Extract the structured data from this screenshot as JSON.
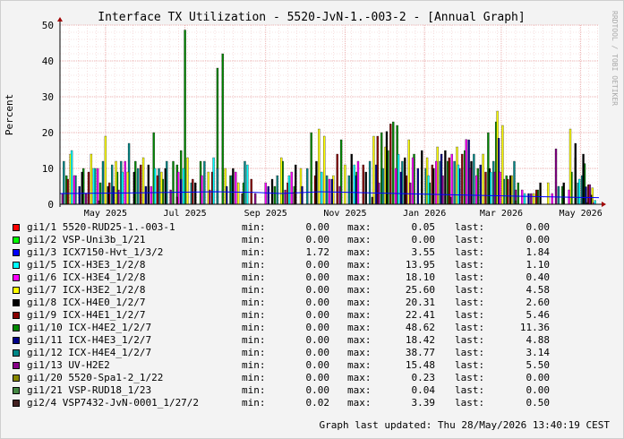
{
  "chart_data": {
    "type": "bar",
    "title": "Interface TX Utilization - 5520-JvN-1.-003-2 - [Annual Graph]",
    "ylabel": "Percent",
    "watermark": "RRDTOOL / TOBI OETIKER",
    "ylim": [
      0,
      50
    ],
    "yticks": [
      "0",
      "10",
      "20",
      "30",
      "40",
      "50"
    ],
    "xticks": [
      {
        "label": "May 2025",
        "day": 35
      },
      {
        "label": "Jul 2025",
        "day": 96
      },
      {
        "label": "Sep 2025",
        "day": 158
      },
      {
        "label": "Nov 2025",
        "day": 219
      },
      {
        "label": "Jan 2026",
        "day": 280
      },
      {
        "label": "Mar 2026",
        "day": 339
      },
      {
        "label": "May 2026",
        "day": 400
      }
    ],
    "x_range_days": [
      0,
      414
    ],
    "grid": true,
    "series": [
      {
        "name": "gi1/10 ICX-H4E2_1/2/7",
        "color": "#008800",
        "points": [
          [
            5,
            8
          ],
          [
            18,
            10
          ],
          [
            31,
            6
          ],
          [
            44,
            9
          ],
          [
            58,
            12
          ],
          [
            72,
            20
          ],
          [
            79,
            7
          ],
          [
            87,
            12
          ],
          [
            90,
            11
          ],
          [
            93,
            15
          ],
          [
            96,
            48.62
          ],
          [
            108,
            12
          ],
          [
            121,
            38
          ],
          [
            125,
            42
          ],
          [
            131,
            8
          ],
          [
            141,
            6
          ],
          [
            165,
            5
          ],
          [
            171,
            12
          ],
          [
            180,
            5
          ],
          [
            193,
            20
          ],
          [
            216,
            18
          ],
          [
            228,
            9
          ],
          [
            247,
            20
          ],
          [
            252,
            15
          ],
          [
            256,
            23
          ],
          [
            259,
            22
          ],
          [
            272,
            14
          ],
          [
            284,
            6
          ],
          [
            298,
            12
          ],
          [
            311,
            15
          ],
          [
            321,
            10
          ],
          [
            329,
            20
          ],
          [
            335,
            23
          ],
          [
            343,
            8
          ],
          [
            352,
            6
          ],
          [
            367,
            4
          ],
          [
            386,
            5
          ],
          [
            393,
            9
          ],
          [
            403,
            11.36
          ]
        ]
      },
      {
        "name": "gi1/12 ICX-H4E4_1/2/7",
        "color": "#008888",
        "points": [
          [
            3,
            12
          ],
          [
            12,
            8
          ],
          [
            27,
            10
          ],
          [
            33,
            12
          ],
          [
            40,
            11
          ],
          [
            47,
            12
          ],
          [
            53,
            17
          ],
          [
            60,
            10
          ],
          [
            76,
            10
          ],
          [
            82,
            12
          ],
          [
            101,
            6
          ],
          [
            111,
            12
          ],
          [
            121,
            10
          ],
          [
            132,
            8
          ],
          [
            142,
            12
          ],
          [
            167,
            8
          ],
          [
            190,
            10
          ],
          [
            205,
            8
          ],
          [
            222,
            8
          ],
          [
            238,
            12
          ],
          [
            248,
            10
          ],
          [
            263,
            12
          ],
          [
            281,
            10
          ],
          [
            292,
            12
          ],
          [
            303,
            12
          ],
          [
            318,
            14
          ],
          [
            333,
            12
          ],
          [
            341,
            7
          ],
          [
            349,
            12
          ],
          [
            383,
            5
          ],
          [
            398,
            6
          ],
          [
            401,
            8
          ],
          [
            407,
            3.14
          ]
        ]
      },
      {
        "name": "gi1/7 ICX-H3E2_1/2/8",
        "color": "#ffff00",
        "points": [
          [
            8,
            14
          ],
          [
            24,
            14
          ],
          [
            35,
            19
          ],
          [
            43,
            12
          ],
          [
            52,
            9
          ],
          [
            64,
            13
          ],
          [
            78,
            9
          ],
          [
            98,
            13
          ],
          [
            114,
            9
          ],
          [
            127,
            10
          ],
          [
            137,
            6
          ],
          [
            170,
            13
          ],
          [
            185,
            10
          ],
          [
            199,
            21
          ],
          [
            203,
            19
          ],
          [
            210,
            8
          ],
          [
            219,
            11
          ],
          [
            241,
            19
          ],
          [
            250,
            16
          ],
          [
            268,
            18
          ],
          [
            282,
            13
          ],
          [
            290,
            16
          ],
          [
            305,
            16
          ],
          [
            325,
            14
          ],
          [
            336,
            26
          ],
          [
            340,
            22
          ],
          [
            347,
            8
          ],
          [
            364,
            3
          ],
          [
            375,
            6
          ],
          [
            392,
            21
          ],
          [
            409,
            4.58
          ]
        ]
      },
      {
        "name": "gi1/9 ICX-H4E1_1/2/7",
        "color": "#880000",
        "points": [
          [
            6,
            7
          ],
          [
            22,
            9
          ],
          [
            38,
            6
          ],
          [
            62,
            11
          ],
          [
            75,
            8
          ],
          [
            102,
            7
          ],
          [
            117,
            9
          ],
          [
            147,
            7
          ],
          [
            175,
            6
          ],
          [
            196,
            8
          ],
          [
            213,
            14
          ],
          [
            233,
            11
          ],
          [
            244,
            19
          ],
          [
            254,
            22.41
          ],
          [
            266,
            8
          ],
          [
            286,
            11
          ],
          [
            299,
            13
          ],
          [
            309,
            14
          ],
          [
            327,
            9
          ],
          [
            344,
            7
          ],
          [
            366,
            4
          ],
          [
            396,
            13
          ],
          [
            406,
            5.46
          ]
        ]
      },
      {
        "name": "gi1/11 ICX-H4E3_1/2/7",
        "color": "#000088",
        "points": [
          [
            15,
            5
          ],
          [
            41,
            5
          ],
          [
            66,
            5
          ],
          [
            93,
            7
          ],
          [
            128,
            5
          ],
          [
            160,
            5
          ],
          [
            186,
            5
          ],
          [
            209,
            7
          ],
          [
            227,
            8
          ],
          [
            243,
            11
          ],
          [
            262,
            9
          ],
          [
            275,
            10
          ],
          [
            293,
            14
          ],
          [
            307,
            10
          ],
          [
            314,
            18
          ],
          [
            323,
            11
          ],
          [
            337,
            18.42
          ],
          [
            360,
            3
          ],
          [
            404,
            4.88
          ]
        ]
      },
      {
        "name": "gi1/8 ICX-H4E0_1/2/7",
        "color": "#000000",
        "points": [
          [
            17,
            9
          ],
          [
            37,
            5
          ],
          [
            57,
            9
          ],
          [
            68,
            11
          ],
          [
            81,
            10
          ],
          [
            104,
            6
          ],
          [
            133,
            10
          ],
          [
            163,
            7
          ],
          [
            181,
            11
          ],
          [
            197,
            12
          ],
          [
            224,
            14
          ],
          [
            235,
            9
          ],
          [
            251,
            20.31
          ],
          [
            265,
            13
          ],
          [
            278,
            15
          ],
          [
            287,
            10
          ],
          [
            296,
            15
          ],
          [
            316,
            12
          ],
          [
            330,
            10
          ],
          [
            346,
            8
          ],
          [
            369,
            6
          ],
          [
            387,
            6
          ],
          [
            396,
            17
          ],
          [
            402,
            14
          ],
          [
            408,
            2.6
          ]
        ]
      },
      {
        "name": "gi1/6 ICX-H3E4_1/2/8",
        "color": "#ff00ff",
        "points": [
          [
            11,
            8
          ],
          [
            29,
            10
          ],
          [
            50,
            12
          ],
          [
            70,
            5
          ],
          [
            91,
            9
          ],
          [
            109,
            8
          ],
          [
            135,
            9
          ],
          [
            158,
            6
          ],
          [
            178,
            9
          ],
          [
            207,
            7
          ],
          [
            229,
            12
          ],
          [
            258,
            10
          ],
          [
            271,
            13
          ],
          [
            289,
            12
          ],
          [
            301,
            14
          ],
          [
            312,
            18.1
          ],
          [
            320,
            8
          ],
          [
            338,
            9
          ],
          [
            355,
            4
          ],
          [
            378,
            3
          ],
          [
            391,
            4
          ],
          [
            410,
            0.4
          ]
        ]
      },
      {
        "name": "gi1/5 ICX-H3E3_1/2/8",
        "color": "#00ffff",
        "points": [
          [
            9,
            15
          ],
          [
            26,
            10
          ],
          [
            48,
            9
          ],
          [
            73,
            10
          ],
          [
            95,
            10
          ],
          [
            118,
            13
          ],
          [
            144,
            11
          ],
          [
            176,
            8
          ],
          [
            201,
            9
          ],
          [
            226,
            11
          ],
          [
            260,
            13.95
          ],
          [
            283,
            8
          ],
          [
            306,
            11
          ],
          [
            331,
            9
          ],
          [
            357,
            3
          ],
          [
            399,
            7
          ],
          [
            411,
            1.1
          ]
        ]
      },
      {
        "name": "gi1/13 UV-H2E2",
        "color": "#880088",
        "points": [
          [
            2,
            3
          ],
          [
            20,
            3
          ],
          [
            45,
            4
          ],
          [
            85,
            4
          ],
          [
            115,
            4
          ],
          [
            150,
            3
          ],
          [
            173,
            4
          ],
          [
            215,
            5
          ],
          [
            245,
            6
          ],
          [
            269,
            6
          ],
          [
            294,
            8
          ],
          [
            315,
            10
          ],
          [
            334,
            9
          ],
          [
            350,
            4
          ],
          [
            362,
            3
          ],
          [
            381,
            15.48
          ],
          [
            407,
            5.5
          ]
        ]
      },
      {
        "name": "gi1/3 ICX7150-Hvt_1/3/2",
        "color": "#0000ff",
        "line": true,
        "points": [
          [
            0,
            3
          ],
          [
            60,
            3.2
          ],
          [
            120,
            3.5
          ],
          [
            150,
            3.3
          ],
          [
            170,
            3.0
          ],
          [
            200,
            3.5
          ],
          [
            260,
            3.0
          ],
          [
            320,
            2.5
          ],
          [
            360,
            2.2
          ],
          [
            400,
            1.9
          ],
          [
            414,
            1.84
          ]
        ]
      },
      {
        "name": "gi2/4 VSP7432-JvN-0001_1/27/2",
        "color": "#442222",
        "points": [
          [
            30,
            1
          ],
          [
            90,
            2
          ],
          [
            140,
            3
          ],
          [
            180,
            3.39
          ],
          [
            240,
            2
          ],
          [
            300,
            2
          ],
          [
            350,
            1
          ],
          [
            405,
            0.5
          ]
        ]
      },
      {
        "name": "gi1/1 5520-RUD25-1.-003-1",
        "color": "#ff0000",
        "points": []
      },
      {
        "name": "gi1/2 VSP-Uni3b_1/21",
        "color": "#00ff00",
        "points": []
      },
      {
        "name": "gi1/20 5520-Spa1-2_1/22",
        "color": "#888800",
        "points": []
      },
      {
        "name": "gi1/21 VSP-RUD18_1/23",
        "color": "#448844",
        "points": []
      }
    ]
  },
  "legend": [
    {
      "color": "#ff0000",
      "name": "gi1/1 5520-RUD25-1.-003-1",
      "min": "0.00",
      "max": "0.05",
      "last": "0.00"
    },
    {
      "color": "#00ff00",
      "name": "gi1/2 VSP-Uni3b_1/21",
      "min": "0.00",
      "max": "0.00",
      "last": "0.00"
    },
    {
      "color": "#0000ff",
      "name": "gi1/3 ICX7150-Hvt_1/3/2",
      "min": "1.72",
      "max": "3.55",
      "last": "1.84"
    },
    {
      "color": "#00ffff",
      "name": "gi1/5 ICX-H3E3_1/2/8",
      "min": "0.00",
      "max": "13.95",
      "last": "1.10"
    },
    {
      "color": "#ff00ff",
      "name": "gi1/6 ICX-H3E4_1/2/8",
      "min": "0.00",
      "max": "18.10",
      "last": "0.40"
    },
    {
      "color": "#ffff00",
      "name": "gi1/7 ICX-H3E2_1/2/8",
      "min": "0.00",
      "max": "25.60",
      "last": "4.58"
    },
    {
      "color": "#000000",
      "name": "gi1/8 ICX-H4E0_1/2/7",
      "min": "0.00",
      "max": "20.31",
      "last": "2.60"
    },
    {
      "color": "#880000",
      "name": "gi1/9 ICX-H4E1_1/2/7",
      "min": "0.00",
      "max": "22.41",
      "last": "5.46"
    },
    {
      "color": "#008800",
      "name": "gi1/10 ICX-H4E2_1/2/7",
      "min": "0.00",
      "max": "48.62",
      "last": "11.36"
    },
    {
      "color": "#000088",
      "name": "gi1/11 ICX-H4E3_1/2/7",
      "min": "0.00",
      "max": "18.42",
      "last": "4.88"
    },
    {
      "color": "#008888",
      "name": "gi1/12 ICX-H4E4_1/2/7",
      "min": "0.00",
      "max": "38.77",
      "last": "3.14"
    },
    {
      "color": "#880088",
      "name": "gi1/13 UV-H2E2",
      "min": "0.00",
      "max": "15.48",
      "last": "5.50"
    },
    {
      "color": "#888800",
      "name": "gi1/20 5520-Spa1-2_1/22",
      "min": "0.00",
      "max": "0.23",
      "last": "0.00"
    },
    {
      "color": "#448844",
      "name": "gi1/21 VSP-RUD18_1/23",
      "min": "0.00",
      "max": "0.04",
      "last": "0.00"
    },
    {
      "color": "#442222",
      "name": "gi2/4 VSP7432-JvN-0001_1/27/2",
      "min": "0.02",
      "max": "3.39",
      "last": "0.50"
    }
  ],
  "labels": {
    "min": "min:",
    "max": "max:",
    "last": "last:"
  },
  "footer": "Graph last updated: Thu 28/May/2026 13:40:19 CEST"
}
